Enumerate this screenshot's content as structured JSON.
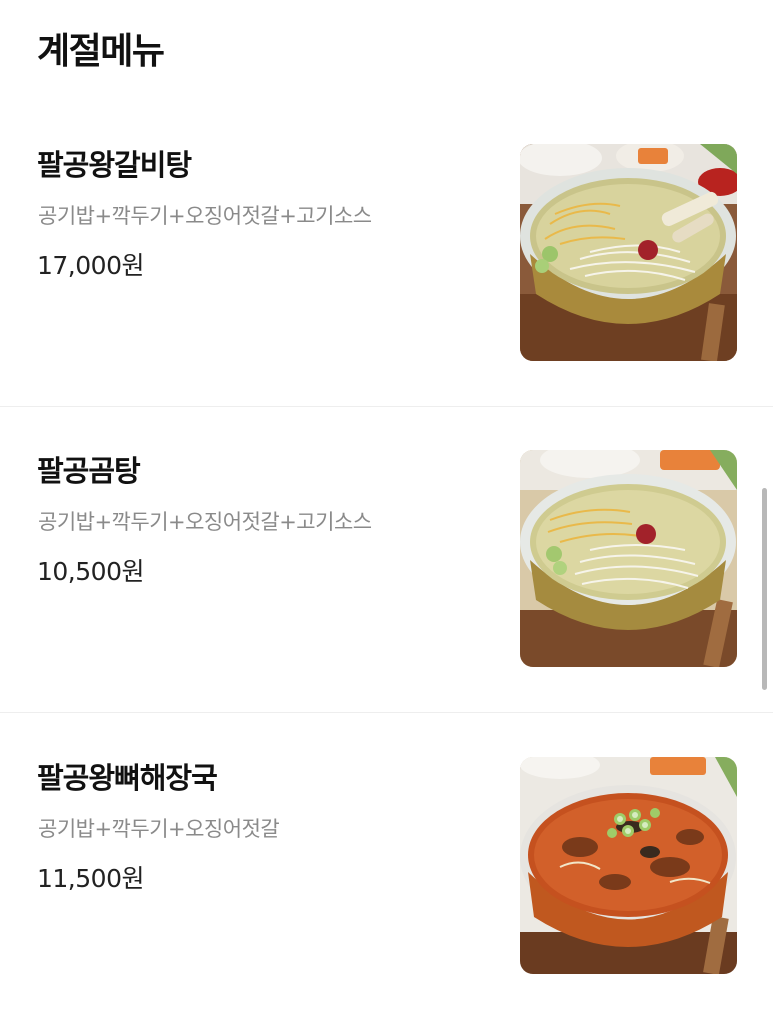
{
  "section": {
    "title": "계절메뉴"
  },
  "menu": {
    "items": [
      {
        "name": "팔공왕갈비탕",
        "description": "공기밥+깍두기+오징어젓갈+고기소스",
        "price": "17,000원",
        "image_icon": "galbitang-photo"
      },
      {
        "name": "팔공곰탕",
        "description": "공기밥+깍두기+오징어젓갈+고기소스",
        "price": "10,500원",
        "image_icon": "gomtang-photo"
      },
      {
        "name": "팔공왕뼈해장국",
        "description": "공기밥+깍두기+오징어젓갈",
        "price": "11,500원",
        "image_icon": "haejangguk-photo"
      }
    ]
  },
  "scrollbar": {
    "position_fraction": 0.48
  }
}
